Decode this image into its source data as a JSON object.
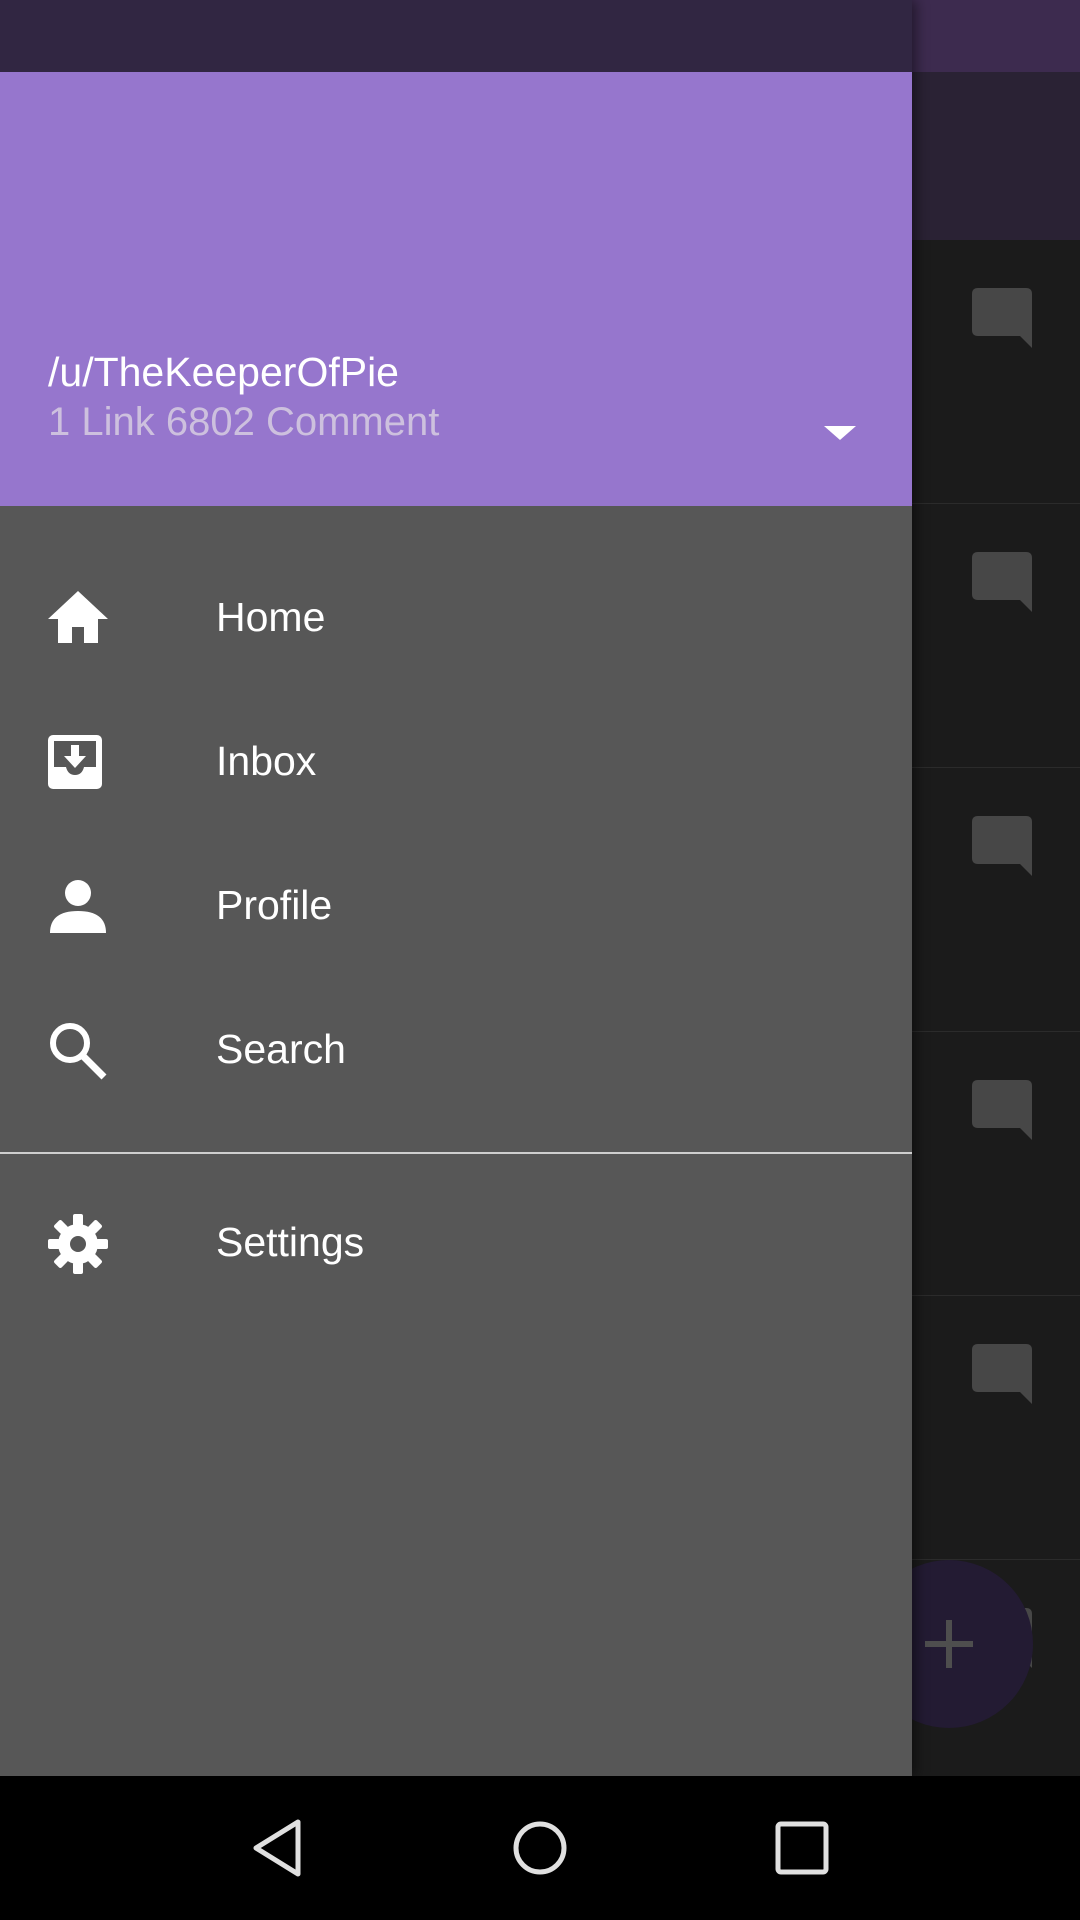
{
  "drawer": {
    "header": {
      "username": "/u/TheKeeperOfPie",
      "karma": "1 Link 6802 Comment"
    },
    "menu": [
      {
        "label": "Home",
        "icon": "home-icon"
      },
      {
        "label": "Inbox",
        "icon": "inbox-icon"
      },
      {
        "label": "Profile",
        "icon": "person-icon"
      },
      {
        "label": "Search",
        "icon": "search-icon"
      }
    ],
    "settings": {
      "label": "Settings",
      "icon": "gear-icon"
    }
  },
  "background": {
    "fab_icon": "plus-icon",
    "row_icon": "comment-icon"
  },
  "colors": {
    "drawer_header": "#9676cd",
    "drawer_body": "#575757",
    "status_bar": "#312642",
    "toolbar": "#2a2234",
    "feed_background": "#1b1b1b"
  },
  "nav_bar": {
    "buttons": [
      "back-icon",
      "home-circle-icon",
      "recents-icon"
    ]
  }
}
